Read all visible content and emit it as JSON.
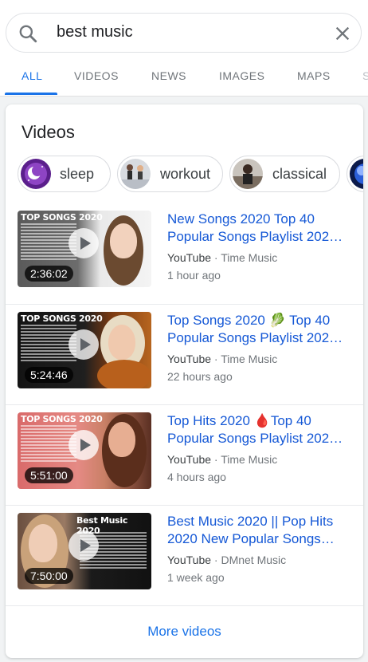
{
  "search": {
    "query": "best music"
  },
  "tabs": [
    "ALL",
    "VIDEOS",
    "NEWS",
    "IMAGES",
    "MAPS",
    "S"
  ],
  "card_title": "Videos",
  "chips": [
    {
      "label": "sleep",
      "icon": "moon-icon"
    },
    {
      "label": "workout",
      "icon": "workout-thumbnail"
    },
    {
      "label": "classical",
      "icon": "classical-thumbnail"
    },
    {
      "label": "",
      "icon": "earth-icon"
    }
  ],
  "videos": [
    {
      "title_line1": "New Songs 2020 Top 40",
      "title_line2": "Popular Songs Playlist 202…",
      "source": "YouTube",
      "channel": "· Time Music",
      "age": "1 hour ago",
      "duration": "2:36:02",
      "thumb_heading": "TOP SONGS 2020"
    },
    {
      "title_line1": "Top Songs 2020 🥬 Top 40",
      "title_line2": "Popular Songs Playlist 202…",
      "source": "YouTube",
      "channel": "· Time Music",
      "age": "22 hours ago",
      "duration": "5:24:46",
      "thumb_heading": "TOP SONGS 2020"
    },
    {
      "title_line1": "Top Hits 2020 🩸Top 40",
      "title_line2": "Popular Songs Playlist 202…",
      "source": "YouTube",
      "channel": "· Time Music",
      "age": "4 hours ago",
      "duration": "5:51:00",
      "thumb_heading": "TOP SONGS 2020"
    },
    {
      "title_line1": "Best Music 2020 || Pop Hits",
      "title_line2": "2020 New Popular Songs…",
      "source": "YouTube",
      "channel": "· DMnet Music",
      "age": "1 week ago",
      "duration": "7:50:00",
      "thumb_heading": "Best Music 2020"
    }
  ],
  "more_label": "More videos",
  "colors": {
    "accent": "#1a73e8",
    "link": "#1558d6",
    "muted": "#70757a"
  }
}
